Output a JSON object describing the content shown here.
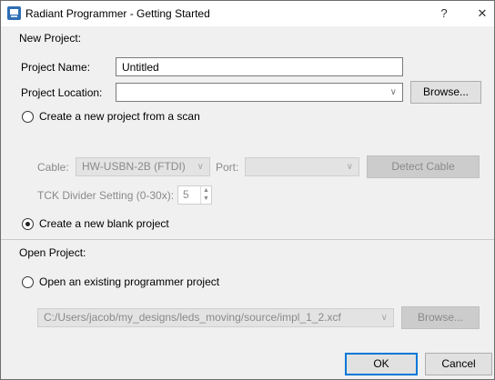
{
  "window": {
    "title": "Radiant Programmer - Getting Started",
    "help_glyph": "?",
    "close_glyph": "✕"
  },
  "new_project": {
    "section_title": "New Project:",
    "name_label": "Project Name:",
    "name_value": "Untitled",
    "location_label": "Project Location:",
    "location_value": "",
    "browse_label": "Browse...",
    "scan_radio_label": "Create a new project from a scan",
    "scan_selected": false,
    "cable_label": "Cable:",
    "cable_value": "HW-USBN-2B (FTDI)",
    "port_label": "Port:",
    "port_value": "",
    "detect_cable_label": "Detect Cable",
    "tck_label": "TCK Divider Setting (0-30x):",
    "tck_value": "5",
    "blank_radio_label": "Create a new blank project",
    "blank_selected": true
  },
  "open_project": {
    "section_title": "Open Project:",
    "existing_radio_label": "Open an existing programmer project",
    "existing_selected": false,
    "path_value": "C:/Users/jacob/my_designs/leds_moving/source/impl_1_2.xcf",
    "browse_label": "Browse..."
  },
  "footer": {
    "ok_label": "OK",
    "cancel_label": "Cancel"
  },
  "icons": {
    "dropdown_arrow": "∨",
    "spin_up": "▲",
    "spin_down": "▼"
  },
  "colors": {
    "dialog_bg": "#f0f0f0",
    "default_button_border": "#0078d7",
    "disabled_text": "#8a8a8a"
  }
}
